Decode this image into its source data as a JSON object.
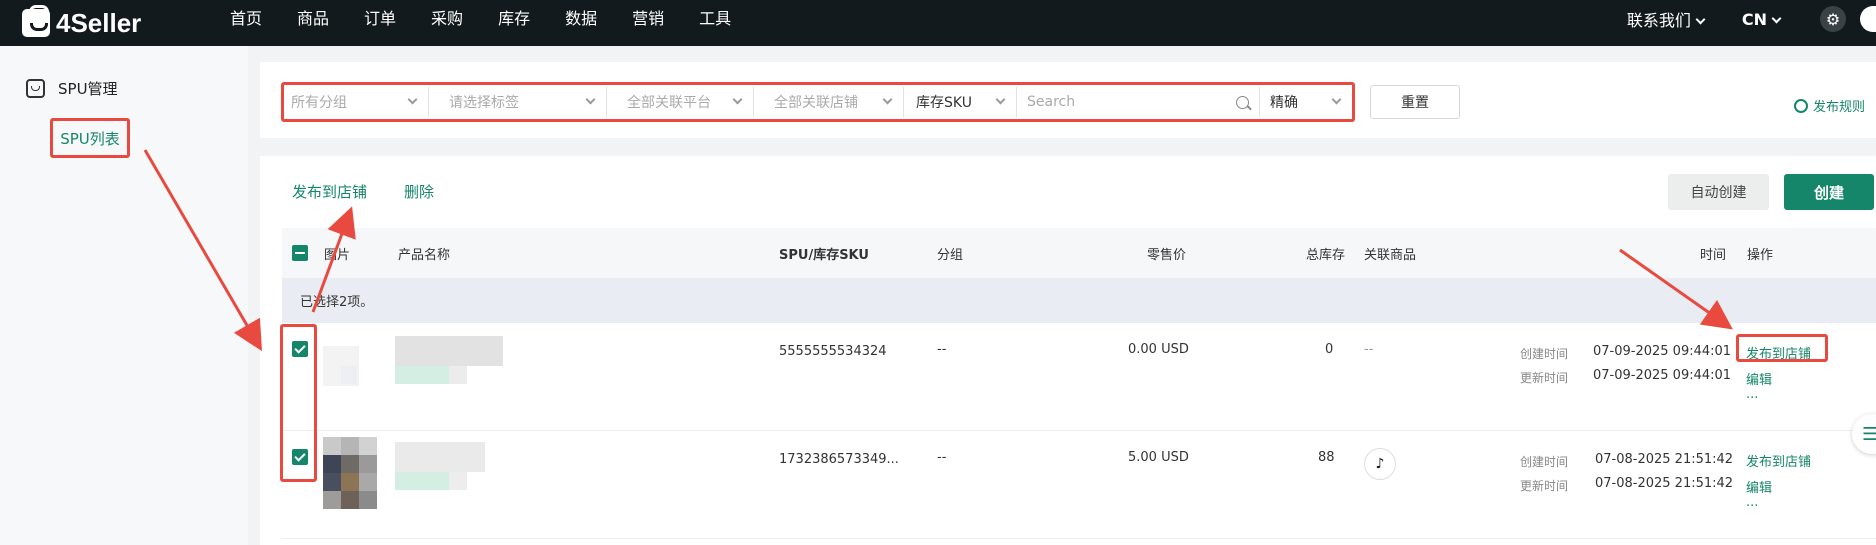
{
  "app": {
    "logo": "4Seller"
  },
  "nav": [
    "首页",
    "商品",
    "订单",
    "采购",
    "库存",
    "数据",
    "营销",
    "工具"
  ],
  "top_right": {
    "contact": "联系我们",
    "lang": "CN"
  },
  "sidebar": {
    "section": "SPU管理",
    "item": "SPU列表"
  },
  "filters": {
    "group": "所有分组",
    "tag": "请选择标签",
    "platform": "全部关联平台",
    "store": "全部关联店铺",
    "field": "库存SKU",
    "search_placeholder": "Search",
    "match": "精确",
    "reset": "重置",
    "rules": "发布规则"
  },
  "actions": {
    "publish": "发布到店铺",
    "delete": "删除",
    "auto_create": "自动创建",
    "create": "创建"
  },
  "table": {
    "headers": {
      "image": "图片",
      "name": "产品名称",
      "spu": "SPU/库存SKU",
      "group": "分组",
      "price": "零售价",
      "stock": "总库存",
      "linked": "关联商品",
      "time": "时间",
      "ops": "操作"
    },
    "selected_text": "已选择2项。",
    "time_labels": {
      "created": "创建时间",
      "updated": "更新时间"
    },
    "row_actions": {
      "publish": "发布到店铺",
      "edit": "编辑",
      "more": "..."
    },
    "rows": [
      {
        "spu": "5555555534324",
        "group": "--",
        "price": "0.00 USD",
        "stock": "0",
        "linked": "--",
        "created": "07-09-2025 09:44:01",
        "updated": "07-09-2025 09:44:01",
        "checked": true
      },
      {
        "spu": "1732386573349...",
        "group": "--",
        "price": "5.00 USD",
        "stock": "88",
        "linked_icon": "tiktok-icon",
        "created": "07-08-2025 21:51:42",
        "updated": "07-08-2025 21:51:42",
        "checked": true
      }
    ]
  },
  "colors": {
    "brand": "#16866a",
    "topbar": "#131a1d",
    "highlight": "#e84a3f"
  }
}
